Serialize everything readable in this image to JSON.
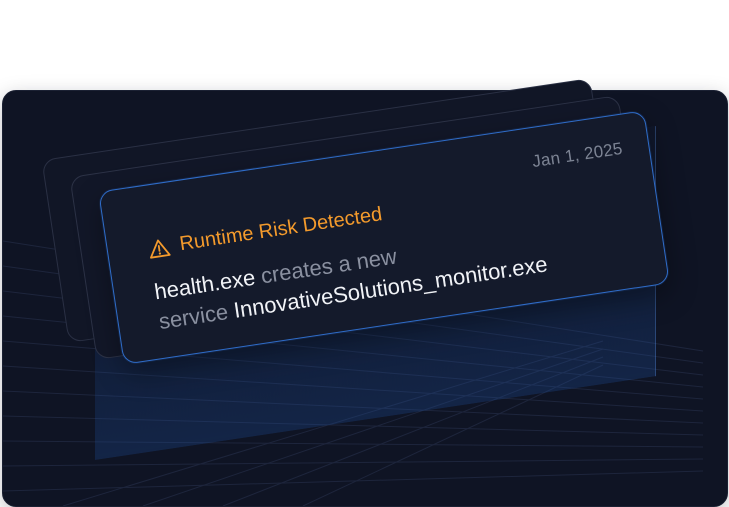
{
  "alert": {
    "date": "Jan 1, 2025",
    "title": "Runtime Risk Detected",
    "warning_icon": "warning-triangle-icon",
    "body": {
      "process": "health.exe",
      "action": "creates a new",
      "noun": "service",
      "service_name": "InnovativeSolutions_monitor.exe"
    }
  },
  "colors": {
    "panel_bg": "#0f1424",
    "card_bg": "#141a2b",
    "card_border": "#2f6cc8",
    "accent_orange": "#f39a2c",
    "text_primary": "#f1f3f7",
    "text_muted": "#8a90a0",
    "date_text": "#7d8494"
  }
}
